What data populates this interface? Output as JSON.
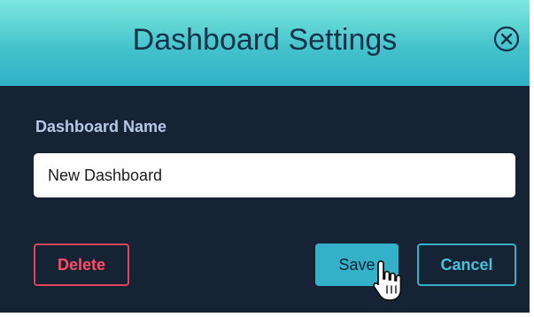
{
  "dialog": {
    "title": "Dashboard Settings",
    "close_icon": "close-circle-icon"
  },
  "form": {
    "name_label": "Dashboard Name",
    "name_value": "New Dashboard"
  },
  "actions": {
    "delete_label": "Delete",
    "save_label": "Save",
    "cancel_label": "Cancel"
  },
  "cursor": {
    "icon": "hand-pointer-icon"
  },
  "colors": {
    "header_top": "#7de8de",
    "header_bottom": "#2fb1c8",
    "body_bg": "#152335",
    "accent": "#35b0c9",
    "danger": "#e0445a"
  }
}
